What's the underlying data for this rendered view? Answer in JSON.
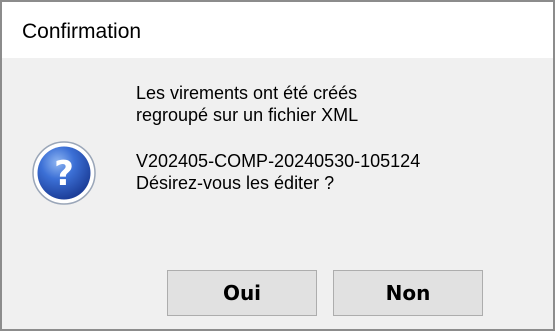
{
  "window": {
    "title": "Confirmation"
  },
  "dialog": {
    "icon": "question-icon",
    "message_lines": [
      "Les virements ont été créés",
      "regroupé sur un fichier XML",
      "V202405-COMP-20240530-105124",
      "Désirez-vous les éditer ?"
    ],
    "buttons": {
      "yes_label": "Oui",
      "no_label": "Non"
    }
  },
  "colors": {
    "dialog_background": "#f0f0f0",
    "icon_blue": "#2a5cc8",
    "button_face": "#e1e1e1"
  }
}
